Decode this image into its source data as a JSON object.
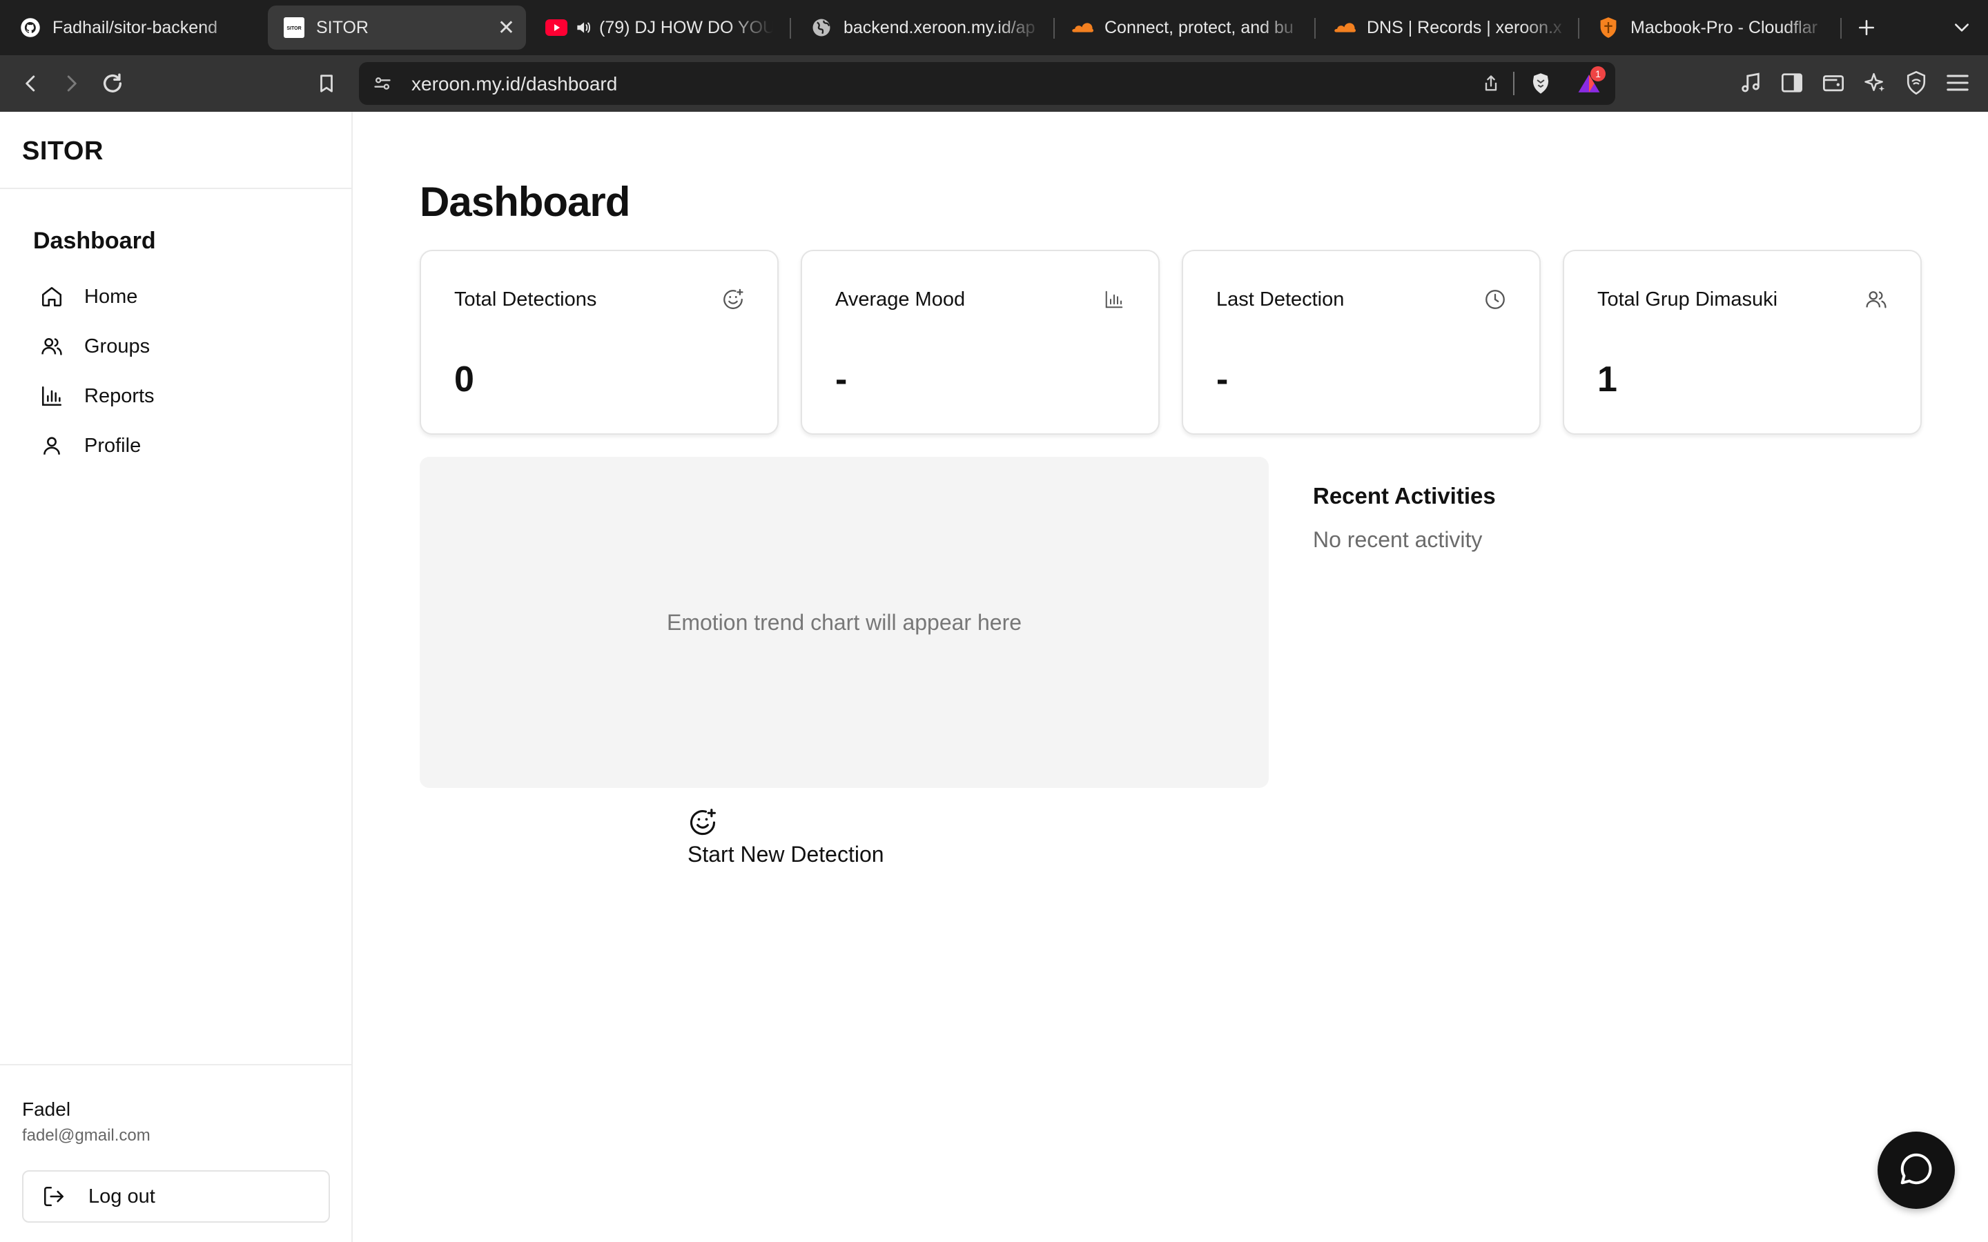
{
  "browser": {
    "tabs": [
      {
        "title": "Fadhail/sitor-backend",
        "icon": "github-icon",
        "active": false
      },
      {
        "title": "SITOR",
        "icon": "sitor-favicon",
        "active": true,
        "favicon_text": "SITOR"
      },
      {
        "title": "(79) DJ HOW DO YOU",
        "icon": "youtube-icon",
        "active": false,
        "audio": true
      },
      {
        "title": "backend.xeroon.my.id/ap",
        "icon": "globe-icon",
        "active": false
      },
      {
        "title": "Connect, protect, and bu",
        "icon": "cloudflare-icon",
        "active": false
      },
      {
        "title": "DNS | Records | xeroon.x",
        "icon": "cloudflare-icon",
        "active": false
      },
      {
        "title": "Macbook-Pro - Cloudflar",
        "icon": "warp-shield-icon",
        "active": false
      }
    ],
    "new_tab_icon": "plus-icon",
    "tab_list_icon": "chevron-down-icon",
    "url": "xeroon.my.id/dashboard",
    "rewards_badge": "1"
  },
  "sidebar": {
    "brand": "SITOR",
    "heading": "Dashboard",
    "items": [
      {
        "label": "Home",
        "icon": "home-icon"
      },
      {
        "label": "Groups",
        "icon": "users-icon"
      },
      {
        "label": "Reports",
        "icon": "bar-chart-icon"
      },
      {
        "label": "Profile",
        "icon": "user-icon"
      }
    ],
    "user": {
      "name": "Fadel",
      "email": "fadel@gmail.com"
    },
    "logout_label": "Log out"
  },
  "main": {
    "title": "Dashboard",
    "stats": [
      {
        "label": "Total Detections",
        "value": "0",
        "icon": "smile-plus-icon"
      },
      {
        "label": "Average Mood",
        "value": "-",
        "icon": "bar-chart-icon"
      },
      {
        "label": "Last Detection",
        "value": "-",
        "icon": "clock-icon"
      },
      {
        "label": "Total Grup Dimasuki",
        "value": "1",
        "icon": "users-icon"
      }
    ],
    "chart_placeholder": "Emotion trend chart will appear here",
    "start_detection_label": "Start New Detection",
    "recent": {
      "title": "Recent Activities",
      "empty": "No recent activity"
    }
  },
  "colors": {
    "accent": "#121212",
    "muted_text": "#6b6b6b",
    "chart_bg": "#f4f4f4"
  }
}
